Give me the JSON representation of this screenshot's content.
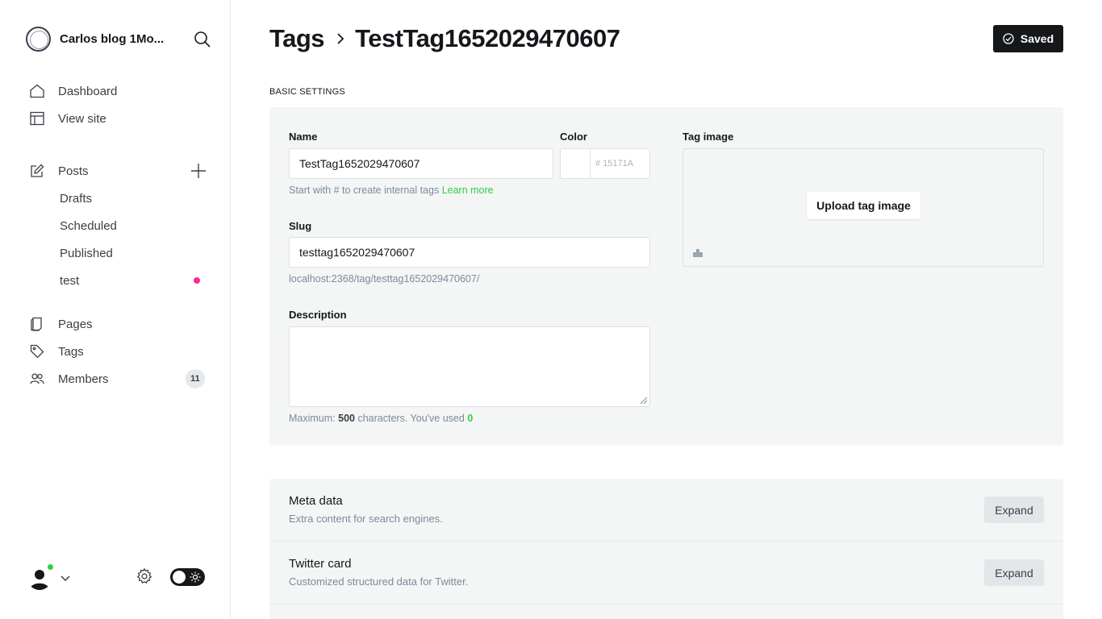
{
  "sidebar": {
    "site_title": "Carlos blog 1Mo...",
    "nav_primary": [
      {
        "label": "Dashboard",
        "icon": "home-icon"
      },
      {
        "label": "View site",
        "icon": "layout-icon"
      }
    ],
    "posts": {
      "label": "Posts",
      "sub": [
        {
          "label": "Drafts"
        },
        {
          "label": "Scheduled"
        },
        {
          "label": "Published"
        },
        {
          "label": "test"
        }
      ]
    },
    "nav_secondary": [
      {
        "label": "Pages",
        "icon": "pages-icon"
      },
      {
        "label": "Tags",
        "icon": "tag-icon"
      },
      {
        "label": "Members",
        "icon": "members-icon",
        "count": "11"
      }
    ],
    "test_dot_color": "#fb2d8d"
  },
  "header": {
    "breadcrumb": "Tags",
    "title": "TestTag1652029470607",
    "saved_label": "Saved"
  },
  "basic": {
    "section_label": "BASIC SETTINGS",
    "name_label": "Name",
    "name_value": "TestTag1652029470607",
    "name_hint": "Start with # to create internal tags",
    "learn_more": "Learn more",
    "color_label": "Color",
    "color_hex": "# 15171A",
    "slug_label": "Slug",
    "slug_value": "testtag1652029470607",
    "slug_url": "localhost:2368/tag/testtag1652029470607/",
    "description_label": "Description",
    "description_value": "",
    "desc_hint_prefix": "Maximum:",
    "desc_max": "500",
    "desc_hint_mid": "characters. You've used",
    "desc_used": "0",
    "image_label": "Tag image",
    "upload_label": "Upload tag image"
  },
  "expandables": [
    {
      "title": "Meta data",
      "subtitle": "Extra content for search engines.",
      "button": "Expand"
    },
    {
      "title": "Twitter card",
      "subtitle": "Customized structured data for Twitter.",
      "button": "Expand"
    }
  ],
  "colors": {
    "accent_green": "#30cf43",
    "dark": "#15171a",
    "panel_bg": "#f4f5f5"
  }
}
